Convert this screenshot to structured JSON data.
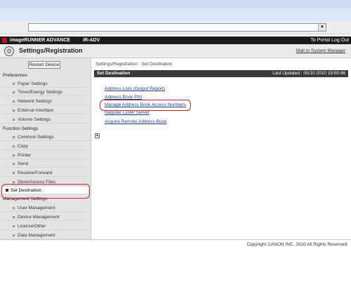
{
  "app_bar": {
    "app_name": "imageRUNNER ADVANCE",
    "device_name": "iR-ADV",
    "to_portal": "To Portal",
    "logout": "Log Out"
  },
  "header": {
    "title": "Settings/Registration",
    "mail_link": "Mail to System Manager"
  },
  "sidebar": {
    "restart_label": "Restart Device",
    "preferences": {
      "heading": "Preferences",
      "items": [
        "Paper Settings",
        "Timer/Energy Settings",
        "Network Settings",
        "External Interface",
        "Volume Settings"
      ]
    },
    "function_settings": {
      "heading": "Function Settings",
      "items": [
        "Common Settings",
        "Copy",
        "Printer",
        "Send",
        "Receive/Forward",
        "Store/Access Files"
      ]
    },
    "active_item": "Set Destination",
    "management": {
      "heading": "Management Settings",
      "items": [
        "User Management",
        "Device Management",
        "License/Other",
        "Data Management"
      ]
    }
  },
  "main": {
    "breadcrumb": "Settings/Registration : Set Destination",
    "panel_title": "Set Destination",
    "last_updated": "Last Updated : 05/10 2010 19:50:46",
    "links": [
      "Address Lists (Output Report)",
      "Address Book PIN",
      "Manage Address Book Access Numbers",
      "Register LDAP Server",
      "Acquire Remote Address Book"
    ]
  },
  "footer": {
    "copyright": "Copyright CANON INC. 2010 All Rights Reserved."
  },
  "colors": {
    "highlight": "#c0282d",
    "app_bar": "#1c1c1c",
    "link": "#1a3f8c"
  }
}
